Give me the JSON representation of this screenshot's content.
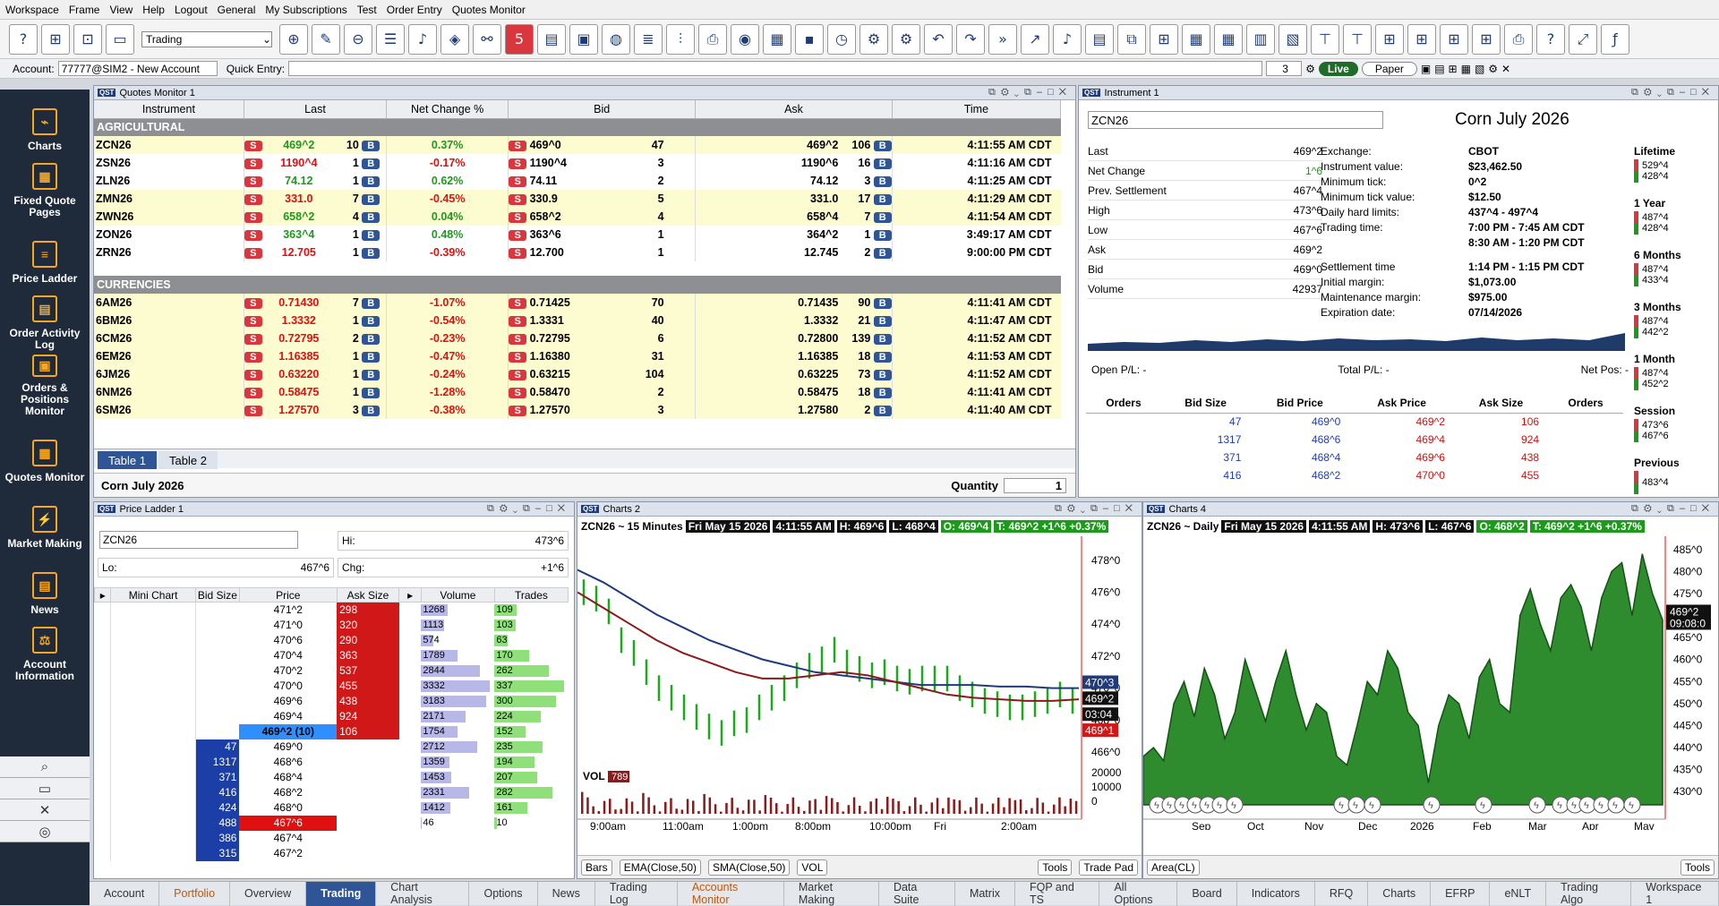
{
  "menu": [
    "Workspace",
    "Frame",
    "View",
    "Help",
    "Logout",
    "General",
    "My Subscriptions",
    "Test",
    "Order Entry",
    "Quotes Monitor"
  ],
  "toolbar": {
    "workspace_select": "Trading",
    "badge": "5"
  },
  "account": {
    "label": "Account:",
    "value": "77777@SIM2 - New Account",
    "quick_entry_label": "Quick Entry:",
    "qty": "3",
    "live": "Live",
    "paper": "Paper"
  },
  "sidebar": [
    {
      "label": "Charts",
      "icon": "charts-icon"
    },
    {
      "label": "Fixed Quote Pages",
      "icon": "fixed-quote-icon"
    },
    {
      "label": "Price Ladder",
      "icon": "price-ladder-icon"
    },
    {
      "label": "Order Activity Log",
      "icon": "order-log-icon"
    },
    {
      "label": "Orders & Positions Monitor",
      "icon": "orders-positions-icon"
    },
    {
      "label": "Quotes Monitor",
      "icon": "quotes-monitor-icon"
    },
    {
      "label": "Market Making",
      "icon": "market-making-icon"
    },
    {
      "label": "News",
      "icon": "news-icon"
    },
    {
      "label": "Account Information",
      "icon": "account-info-icon"
    }
  ],
  "quotes": {
    "title": "Quotes Monitor 1",
    "headers": [
      "Instrument",
      "Last",
      "Net Change %",
      "Bid",
      "Ask",
      "Time"
    ],
    "groups": [
      {
        "name": "AGRICULTURAL",
        "rows": [
          [
            "ZCN26",
            "469^2",
            "10",
            "0.37%",
            "469^0",
            "47",
            "469^2",
            "106",
            "4:11:55 AM CDT",
            "up"
          ],
          [
            "ZSN26",
            "1190^4",
            "1",
            "-0.17%",
            "1190^4",
            "3",
            "1190^6",
            "16",
            "4:11:16 AM CDT",
            "dn"
          ],
          [
            "ZLN26",
            "74.12",
            "1",
            "0.62%",
            "74.11",
            "2",
            "74.12",
            "3",
            "4:11:25 AM CDT",
            "up"
          ],
          [
            "ZMN26",
            "331.0",
            "7",
            "-0.45%",
            "330.9",
            "5",
            "331.0",
            "17",
            "4:11:29 AM CDT",
            "dn"
          ],
          [
            "ZWN26",
            "658^2",
            "4",
            "0.04%",
            "658^2",
            "4",
            "658^4",
            "7",
            "4:11:54 AM CDT",
            "up"
          ],
          [
            "ZON26",
            "363^4",
            "1",
            "0.48%",
            "363^6",
            "1",
            "364^2",
            "1",
            "3:49:17 AM CDT",
            "up"
          ],
          [
            "ZRN26",
            "12.705",
            "1",
            "-0.39%",
            "12.700",
            "1",
            "12.745",
            "2",
            "9:00:00 PM CDT",
            "dn"
          ]
        ]
      },
      {
        "name": "CURRENCIES",
        "rows": [
          [
            "6AM26",
            "0.71430",
            "7",
            "-1.07%",
            "0.71425",
            "70",
            "0.71435",
            "90",
            "4:11:41 AM CDT",
            "dn"
          ],
          [
            "6BM26",
            "1.3332",
            "1",
            "-0.54%",
            "1.3331",
            "40",
            "1.3332",
            "21",
            "4:11:47 AM CDT",
            "dn"
          ],
          [
            "6CM26",
            "0.72795",
            "2",
            "-0.23%",
            "0.72795",
            "6",
            "0.72800",
            "139",
            "4:11:52 AM CDT",
            "dn"
          ],
          [
            "6EM26",
            "1.16385",
            "1",
            "-0.47%",
            "1.16380",
            "31",
            "1.16385",
            "18",
            "4:11:53 AM CDT",
            "dn"
          ],
          [
            "6JM26",
            "0.63220",
            "1",
            "-0.24%",
            "0.63215",
            "104",
            "0.63225",
            "73",
            "4:11:52 AM CDT",
            "dn"
          ],
          [
            "6NM26",
            "0.58475",
            "1",
            "-1.28%",
            "0.58470",
            "2",
            "0.58475",
            "18",
            "4:11:41 AM CDT",
            "dn"
          ],
          [
            "6SM26",
            "1.27570",
            "3",
            "-0.38%",
            "1.27570",
            "3",
            "1.27580",
            "2",
            "4:11:40 AM CDT",
            "dn"
          ]
        ]
      }
    ],
    "tabs": [
      "Table 1",
      "Table 2"
    ],
    "footer_name": "Corn July 2026",
    "qty_label": "Quantity",
    "qty": "1"
  },
  "instrument": {
    "title": "Instrument 1",
    "symbol": "ZCN26",
    "name": "Corn July 2026",
    "left": [
      [
        "Last",
        "469^2"
      ],
      [
        "Net Change",
        "1^6"
      ],
      [
        "Prev. Settlement",
        "467^4"
      ],
      [
        "High",
        "473^6"
      ],
      [
        "Low",
        "467^6"
      ],
      [
        "Ask",
        "469^2"
      ],
      [
        "Bid",
        "469^0"
      ],
      [
        "Volume",
        "42937"
      ]
    ],
    "right": [
      [
        "Exchange:",
        "CBOT"
      ],
      [
        "Instrument value:",
        "$23,462.50"
      ],
      [
        "Minimum tick:",
        "0^2"
      ],
      [
        "Minimum tick value:",
        "$12.50"
      ],
      [
        "Daily hard limits:",
        "437^4 - 497^4"
      ],
      [
        "Trading time:",
        "7:00 PM - 7:45 AM CDT"
      ],
      [
        "",
        "8:30 AM - 1:20 PM CDT"
      ],
      [
        "Settlement time",
        "1:14 PM - 1:15 PM CDT"
      ],
      [
        "Initial margin:",
        "$1,073.00"
      ],
      [
        "Maintenance margin:",
        "$975.00"
      ],
      [
        "Expiration date:",
        "07/14/2026"
      ]
    ],
    "ranges": [
      [
        "Lifetime",
        "529^4",
        "428^4"
      ],
      [
        "1 Year",
        "487^4",
        "428^4"
      ],
      [
        "6 Months",
        "487^4",
        "433^4"
      ],
      [
        "3 Months",
        "487^4",
        "442^2"
      ],
      [
        "1 Month",
        "487^4",
        "452^2"
      ],
      [
        "Session",
        "473^6",
        "467^6"
      ],
      [
        "Previous",
        "483^4",
        ""
      ]
    ],
    "pl": [
      "Open P/L: -",
      "Total P/L: -",
      "Net Pos: -"
    ],
    "dom_headers": [
      "Orders",
      "Bid Size",
      "Bid Price",
      "Ask Price",
      "Ask Size",
      "Orders"
    ],
    "dom": [
      [
        "47",
        "469^0",
        "469^2",
        "106"
      ],
      [
        "1317",
        "468^6",
        "469^4",
        "924"
      ],
      [
        "371",
        "468^4",
        "469^6",
        "438"
      ],
      [
        "416",
        "468^2",
        "470^0",
        "455"
      ]
    ]
  },
  "ladder": {
    "title": "Price Ladder 1",
    "symbol": "ZCN26",
    "hi_label": "Hi:",
    "hi": "473^6",
    "lo_label": "Lo:",
    "lo": "467^6",
    "chg_label": "Chg:",
    "chg": "+1^6",
    "headers": [
      "Mini Chart",
      "Bid Size",
      "Price",
      "Ask Size",
      "Volume",
      "Trades"
    ],
    "rows": [
      [
        "",
        "471^2",
        "298",
        "1268",
        "109"
      ],
      [
        "",
        "471^0",
        "320",
        "1113",
        "103"
      ],
      [
        "",
        "470^6",
        "290",
        "574",
        "63"
      ],
      [
        "",
        "470^4",
        "363",
        "1789",
        "170"
      ],
      [
        "",
        "470^2",
        "537",
        "2844",
        "262"
      ],
      [
        "",
        "470^0",
        "455",
        "3332",
        "337"
      ],
      [
        "",
        "469^6",
        "438",
        "3183",
        "300"
      ],
      [
        "",
        "469^4",
        "924",
        "2171",
        "224"
      ],
      [
        "",
        "469^2 (10)",
        "106",
        "1754",
        "152"
      ],
      [
        "47",
        "469^0",
        "",
        "2712",
        "235"
      ],
      [
        "1317",
        "468^6",
        "",
        "1359",
        "194"
      ],
      [
        "371",
        "468^4",
        "",
        "1453",
        "207"
      ],
      [
        "416",
        "468^2",
        "",
        "2331",
        "282"
      ],
      [
        "424",
        "468^0",
        "",
        "1412",
        "161"
      ],
      [
        "488",
        "467^6",
        "",
        "46",
        "10"
      ],
      [
        "386",
        "467^4",
        "",
        "",
        ""
      ],
      [
        "315",
        "467^2",
        "",
        "",
        ""
      ]
    ]
  },
  "chart2": {
    "title": "Charts 2",
    "header": "ZCN26 ~ 15 Minutes",
    "date": "Fri May 15 2026",
    "time": "4:11:55 AM",
    "h": "H: 469^6",
    "l": "L: 468^4",
    "o": "O: 469^4",
    "t": "T: 469^2 +1^6 +0.37%",
    "yticks": [
      "478^0",
      "476^0",
      "474^0",
      "472^0",
      "470^0",
      "468^0",
      "466^0"
    ],
    "vol_ticks": [
      "20000",
      "10000",
      "0"
    ],
    "xticks": [
      "9:00am",
      "11:00am",
      "1:00pm",
      "8:00pm",
      "10:00pm",
      "Fri",
      "2:00am"
    ],
    "vol_label": "VOL",
    "vol_value": "789",
    "tag_high": "470^3",
    "tag_last": "469^2",
    "tag_timer": "03:04",
    "tag_low": "469^1",
    "footer": [
      "Bars",
      "EMA(Close,50)",
      "SMA(Close,50)",
      "VOL"
    ],
    "tools": "Tools",
    "tradepad": "Trade Pad"
  },
  "chart4": {
    "title": "Charts 4",
    "header": "ZCN26 ~ Daily",
    "date": "Fri May 15 2026",
    "time": "4:11:55 AM",
    "h": "H: 473^6",
    "l": "L: 467^6",
    "o": "O: 468^2",
    "t": "T: 469^2 +1^6 +0.37%",
    "yticks": [
      "485^0",
      "480^0",
      "475^0",
      "470^0",
      "465^0",
      "460^0",
      "455^0",
      "450^0",
      "445^0",
      "440^0",
      "435^0",
      "430^0"
    ],
    "xticks": [
      "Sep",
      "Oct",
      "Nov",
      "Dec",
      "2026",
      "Feb",
      "Mar",
      "Apr",
      "May"
    ],
    "tag_last": "469^2",
    "tag_timer": "09:08:0",
    "footer": [
      "Area(CL)"
    ],
    "tools": "Tools"
  },
  "chart_data": [
    {
      "type": "line",
      "title": "ZCN26 ~ 15 Minutes",
      "series": [
        {
          "name": "Bars",
          "values": [
            476.0,
            475.6,
            474.8,
            473.0,
            472.2,
            471.0,
            470.0,
            469.4,
            468.8,
            468.2,
            467.6,
            467.2,
            467.8,
            468.0,
            468.8,
            469.4,
            470.0,
            470.8,
            471.4,
            471.8,
            472.4,
            471.6,
            471.2,
            470.8,
            471.0,
            470.6,
            470.4,
            470.6,
            470.6,
            470.6,
            470.0,
            469.6,
            469.2,
            469.0,
            468.8,
            468.8,
            469.0,
            469.2,
            469.6,
            469.2
          ]
        },
        {
          "name": "EMA(Close,50)",
          "values": [
            477.4,
            476.6,
            475.6,
            474.6,
            473.8,
            473.0,
            472.4,
            471.8,
            471.4,
            471.0,
            470.8,
            470.6,
            470.4,
            470.2,
            470.2,
            470.2,
            470.1,
            470.1,
            470.0,
            470.0
          ]
        },
        {
          "name": "SMA(Close,50)",
          "values": [
            476.0,
            475.0,
            474.0,
            473.0,
            472.2,
            471.6,
            471.0,
            470.6,
            470.6,
            470.8,
            471.0,
            470.8,
            470.4,
            470.0,
            469.6,
            469.4,
            469.3,
            469.2,
            469.2,
            469.3
          ]
        }
      ],
      "ylim": [
        465.5,
        479.5
      ]
    },
    {
      "type": "area",
      "title": "ZCN26 ~ Daily",
      "series": [
        {
          "name": "Area(CL)",
          "values": [
            438,
            440,
            437,
            450,
            455,
            447,
            458,
            452,
            442,
            448,
            460,
            453,
            446,
            455,
            462,
            452,
            444,
            450,
            448,
            438,
            436,
            445,
            455,
            452,
            462,
            458,
            448,
            445,
            432,
            445,
            452,
            450,
            442,
            456,
            460,
            450,
            448,
            470,
            476,
            468,
            462,
            474,
            477,
            472,
            462,
            474,
            480,
            482,
            470,
            484,
            475,
            469
          ]
        }
      ],
      "ylim": [
        427,
        488
      ]
    }
  ],
  "bottom_tabs": [
    "Account",
    "Portfolio",
    "Overview",
    "Trading",
    "Chart Analysis",
    "Options",
    "News",
    "Trading Log",
    "Accounts Monitor",
    "Market Making",
    "Data Suite",
    "Matrix",
    "FQP and TS",
    "All Options",
    "Board",
    "Indicators",
    "RFQ",
    "Charts",
    "EFRP",
    "eNLT",
    "Trading Algo",
    "Workspace 1"
  ],
  "colors": {
    "up": "#1a9c1a",
    "down": "#e01010",
    "accent": "#2f5597",
    "sidebar": "#1f2b3b",
    "chart_green": "#1e7a2a"
  }
}
